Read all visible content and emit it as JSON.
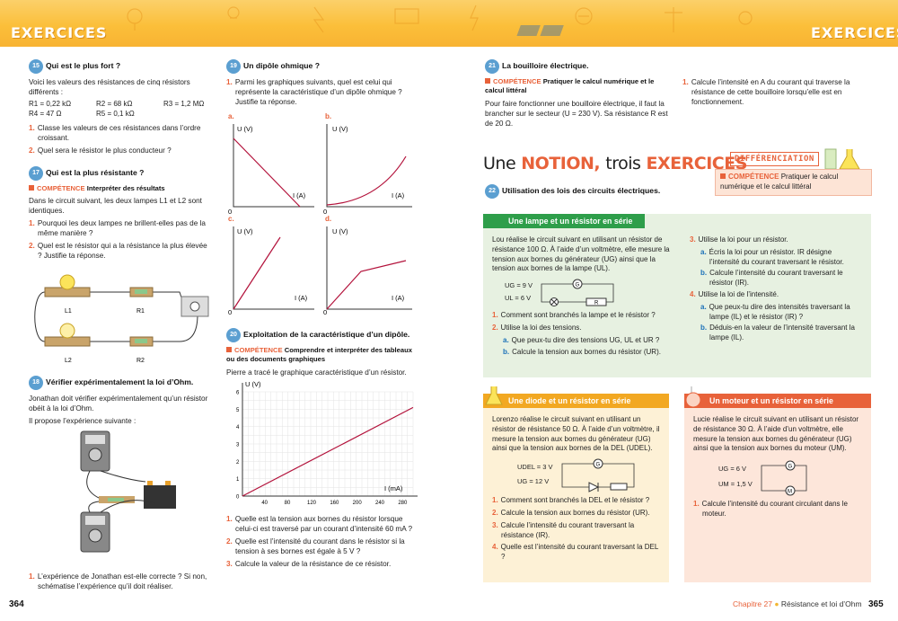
{
  "header": {
    "left_title": "EXERCICES",
    "right_title": "EXERCICES"
  },
  "ex15": {
    "num": "15",
    "title": "Qui est le plus fort ?",
    "intro": "Voici les valeurs des résistances de cinq résistors différents :",
    "values": [
      "R1 = 0,22 kΩ",
      "R2 = 68 kΩ",
      "R3 = 1,2 MΩ",
      "R4 = 47 Ω",
      "R5 = 0,1 kΩ"
    ],
    "q1": "Classe les valeurs de ces résistances dans l’ordre croissant.",
    "q2": "Quel sera le résistor le plus conducteur ?"
  },
  "ex17": {
    "num": "17",
    "title": "Qui est la plus résistante ?",
    "competence_tag": "COMPÉTENCE",
    "competence": "Interpréter des résultats",
    "intro": "Dans le circuit suivant, les deux lampes L1 et L2 sont identiques.",
    "q1": "Pourquoi les deux lampes ne brillent-elles pas de la même manière ?",
    "q2": "Quel est le résistor qui a la résistance la plus élevée ? Justifie ta réponse.",
    "labels": [
      "L1",
      "R1",
      "L2",
      "R2"
    ]
  },
  "ex18": {
    "num": "18",
    "title": "Vérifier expérimentalement la loi d’Ohm.",
    "intro": "Jonathan doit vérifier expérimentalement qu’un résistor obéit à la loi d’Ohm.",
    "intro2": "Il propose l’expérience suivante :",
    "q1": "L’expérience de Jonathan est-elle correcte ? Si non, schématise l’expérience qu’il doit réaliser."
  },
  "ex19": {
    "num": "19",
    "title": "Un dipôle ohmique ?",
    "q1": "Parmi les graphiques suivants, quel est celui qui représente la caractéristique d’un dipôle ohmique ? Justifie ta réponse.",
    "graphs": [
      "a.",
      "b.",
      "c.",
      "d."
    ],
    "ylabel": "U (V)",
    "xlabel": "I (A)",
    "origin": "0"
  },
  "ex20": {
    "num": "20",
    "title": "Exploitation de la caractéristique d’un dipôle.",
    "competence_tag": "COMPÉTENCE",
    "competence": "Comprendre et interpréter des tableaux ou des documents graphiques",
    "intro": "Pierre a tracé le graphique caractéristique d’un résistor.",
    "q1": "Quelle est la tension aux bornes du résistor lorsque celui-ci est traversé par un courant d’intensité 60 mA ?",
    "q2": "Quelle est l’intensité du courant dans le résistor si la tension à ses bornes est égale à 5 V ?",
    "q3": "Calcule la valeur de la résistance de ce résistor."
  },
  "chart_data": {
    "type": "line",
    "title": "",
    "xlabel": "I (mA)",
    "ylabel": "U (V)",
    "xlim": [
      0,
      300
    ],
    "ylim": [
      0,
      6
    ],
    "xticks": [
      40,
      80,
      120,
      160,
      200,
      240,
      280
    ],
    "yticks": [
      0,
      1,
      2,
      3,
      4,
      5,
      6
    ],
    "x": [
      0,
      300
    ],
    "y": [
      0,
      5.1
    ],
    "grid": true
  },
  "ex21": {
    "num": "21",
    "title": "La bouilloire électrique.",
    "competence_tag": "COMPÉTENCE",
    "competence": "Pratiquer le calcul numérique et le calcul littéral",
    "intro": "Pour faire fonctionner une bouilloire électrique, il faut la brancher sur le secteur (U = 230 V). Sa résistance R est de 20 Ω.",
    "q1": "Calcule l’intensité en A du courant qui traverse la résistance de cette bouilloire lorsqu’elle est en fonctionnement."
  },
  "notion": {
    "title_a": "Une",
    "title_b": "NOTION,",
    "title_c": "trois",
    "title_d": "EXERCICES",
    "badge": "DIFFÉRENCIATION",
    "competence_tag": "COMPÉTENCE",
    "competence": "Pratiquer le calcul numérique et le calcul littéral",
    "ex_num": "22",
    "ex_title": "Utilisation des lois des circuits électriques."
  },
  "box1": {
    "title": "Une lampe et un résistor en série",
    "color": "#2e9e4a",
    "intro": "Lou réalise le circuit suivant en utilisant un résistor de résistance 100 Ω. À l’aide d’un voltmètre, elle mesure la tension aux bornes du générateur (UG) ainsi que la tension aux bornes de la lampe (UL).",
    "ug": "UG = 9 V",
    "ul": "UL = 6 V",
    "q1": "Comment sont branchés la lampe et le résistor ?",
    "q2": "Utilise la loi des tensions.",
    "q2a": "Que peux-tu dire des tensions UG, UL et UR ?",
    "q2b": "Calcule la tension aux bornes du résistor (UR).",
    "q3": "Utilise la loi pour un résistor.",
    "q3a": "Écris la loi pour un résistor. IR désigne l’intensité du courant traversant le résistor.",
    "q3b": "Calcule l’intensité du courant traversant le résistor (IR).",
    "q4": "Utilise la loi de l’intensité.",
    "q4a": "Que peux-tu dire des intensités traversant la lampe (IL) et le résistor (IR) ?",
    "q4b": "Déduis-en la valeur de l’intensité traversant la lampe (IL)."
  },
  "box2": {
    "title": "Une diode et un résistor en série",
    "color": "#f2a822",
    "intro": "Lorenzo réalise le circuit suivant en utilisant un résistor de résistance 50 Ω. À l’aide d’un voltmètre, il mesure la tension aux bornes du générateur (UG) ainsi que la tension aux bornes de la DEL (UDEL).",
    "udel": "UDEL = 3 V",
    "ug": "UG = 12 V",
    "q1": "Comment sont branchés la DEL et le résistor ?",
    "q2": "Calcule la tension aux bornes du résistor (UR).",
    "q3": "Calcule l’intensité du courant traversant la résistance (IR).",
    "q4": "Quelle est l’intensité du courant traversant la DEL ?"
  },
  "box3": {
    "title": "Un moteur et un résistor en série",
    "color": "#e8623a",
    "intro": "Lucie réalise le circuit suivant en utilisant un résistor de résistance 30 Ω. À l’aide d’un voltmètre, elle mesure la tension aux bornes du générateur (UG) ainsi que la tension aux bornes du moteur (UM).",
    "ug": "UG = 6 V",
    "um": "UM = 1,5 V",
    "q1": "Calcule l’intensité du courant circulant dans le moteur."
  },
  "footer": {
    "left_page": "364",
    "chapter": "Chapitre 27",
    "chapter_title": "Résistance et loi d’Ohm",
    "right_page": "365"
  }
}
